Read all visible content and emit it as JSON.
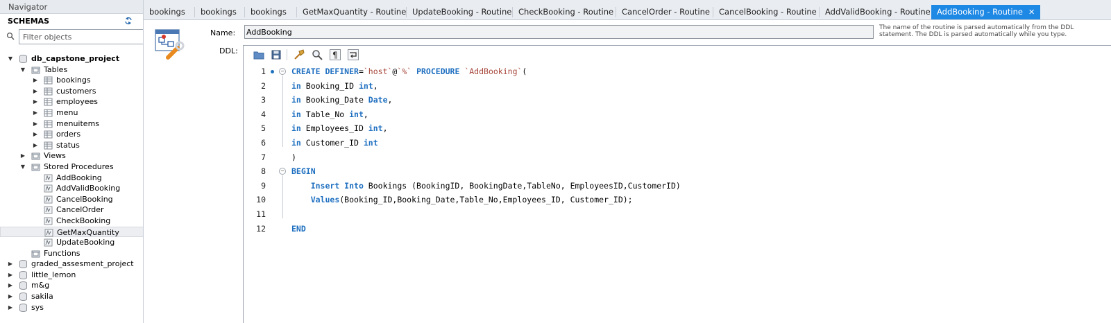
{
  "navigator": {
    "title": "Navigator",
    "schemas_label": "SCHEMAS",
    "filter_placeholder": "Filter objects",
    "tree": [
      {
        "label": "db_capstone_project",
        "level": 0,
        "arrow": "down",
        "icon": "database-icon",
        "bold": true
      },
      {
        "label": "Tables",
        "level": 1,
        "arrow": "down",
        "icon": "folder-icon"
      },
      {
        "label": "bookings",
        "level": 2,
        "arrow": "right",
        "icon": "table-icon"
      },
      {
        "label": "customers",
        "level": 2,
        "arrow": "right",
        "icon": "table-icon"
      },
      {
        "label": "employees",
        "level": 2,
        "arrow": "right",
        "icon": "table-icon"
      },
      {
        "label": "menu",
        "level": 2,
        "arrow": "right",
        "icon": "table-icon"
      },
      {
        "label": "menuitems",
        "level": 2,
        "arrow": "right",
        "icon": "table-icon"
      },
      {
        "label": "orders",
        "level": 2,
        "arrow": "right",
        "icon": "table-icon"
      },
      {
        "label": "status",
        "level": 2,
        "arrow": "right",
        "icon": "table-icon"
      },
      {
        "label": "Views",
        "level": 1,
        "arrow": "right",
        "icon": "folder-icon"
      },
      {
        "label": "Stored Procedures",
        "level": 1,
        "arrow": "down",
        "icon": "folder-icon"
      },
      {
        "label": "AddBooking",
        "level": 2,
        "arrow": "",
        "icon": "routine-icon"
      },
      {
        "label": "AddValidBooking",
        "level": 2,
        "arrow": "",
        "icon": "routine-icon"
      },
      {
        "label": "CancelBooking",
        "level": 2,
        "arrow": "",
        "icon": "routine-icon"
      },
      {
        "label": "CancelOrder",
        "level": 2,
        "arrow": "",
        "icon": "routine-icon"
      },
      {
        "label": "CheckBooking",
        "level": 2,
        "arrow": "",
        "icon": "routine-icon"
      },
      {
        "label": "GetMaxQuantity",
        "level": 2,
        "arrow": "",
        "icon": "routine-icon",
        "selected": true
      },
      {
        "label": "UpdateBooking",
        "level": 2,
        "arrow": "",
        "icon": "routine-icon"
      },
      {
        "label": "Functions",
        "level": 1,
        "arrow": "",
        "icon": "folder-icon"
      },
      {
        "label": "graded_assesment_project",
        "level": 0,
        "arrow": "right",
        "icon": "database-icon"
      },
      {
        "label": "little_lemon",
        "level": 0,
        "arrow": "right",
        "icon": "database-icon"
      },
      {
        "label": "m&g",
        "level": 0,
        "arrow": "right",
        "icon": "database-icon"
      },
      {
        "label": "sakila",
        "level": 0,
        "arrow": "right",
        "icon": "database-icon"
      },
      {
        "label": "sys",
        "level": 0,
        "arrow": "right",
        "icon": "database-icon"
      }
    ]
  },
  "tabs": [
    {
      "label": "bookings"
    },
    {
      "label": "bookings"
    },
    {
      "label": "bookings"
    },
    {
      "label": "GetMaxQuantity - Routine"
    },
    {
      "label": "UpdateBooking - Routine"
    },
    {
      "label": "CheckBooking - Routine"
    },
    {
      "label": "CancelOrder - Routine"
    },
    {
      "label": "CancelBooking - Routine"
    },
    {
      "label": "AddValidBooking - Routine"
    },
    {
      "label": "AddBooking - Routine",
      "active": true
    }
  ],
  "tab_close_glyph": "✕",
  "routine": {
    "name_label": "Name:",
    "name_value": "AddBooking",
    "hint": "The name of the routine is parsed automatically from the DDL statement. The DDL is parsed automatically while you type.",
    "ddl_label": "DDL:"
  },
  "toolbar_icons": [
    "open-folder-icon",
    "save-icon",
    "beautify-icon",
    "find-icon",
    "invisible-chars-icon",
    "word-wrap-icon"
  ],
  "code_lines": [
    {
      "n": "1",
      "marker": true,
      "fold": true,
      "tokens": [
        [
          "kw",
          "CREATE DEFINER"
        ],
        [
          "",
          "="
        ],
        [
          "str",
          "`host`"
        ],
        [
          "",
          "@"
        ],
        [
          "str",
          "`%`"
        ],
        [
          "",
          " "
        ],
        [
          "kw",
          "PROCEDURE"
        ],
        [
          "",
          " "
        ],
        [
          "str",
          "`AddBooking`"
        ],
        [
          "",
          "("
        ]
      ]
    },
    {
      "n": "2",
      "tokens": [
        [
          "kw",
          "in"
        ],
        [
          "",
          " Booking_ID "
        ],
        [
          "ty",
          "int"
        ],
        [
          "",
          ","
        ]
      ]
    },
    {
      "n": "3",
      "tokens": [
        [
          "kw",
          "in"
        ],
        [
          "",
          " Booking_Date "
        ],
        [
          "ty",
          "Date"
        ],
        [
          "",
          ","
        ]
      ]
    },
    {
      "n": "4",
      "tokens": [
        [
          "kw",
          "in"
        ],
        [
          "",
          " Table_No "
        ],
        [
          "ty",
          "int"
        ],
        [
          "",
          ","
        ]
      ]
    },
    {
      "n": "5",
      "tokens": [
        [
          "kw",
          "in"
        ],
        [
          "",
          " Employees_ID "
        ],
        [
          "ty",
          "int"
        ],
        [
          "",
          ","
        ]
      ]
    },
    {
      "n": "6",
      "tokens": [
        [
          "kw",
          "in"
        ],
        [
          "",
          " Customer_ID "
        ],
        [
          "ty",
          "int"
        ]
      ]
    },
    {
      "n": "7",
      "tokens": [
        [
          "",
          ")"
        ]
      ]
    },
    {
      "n": "8",
      "fold": true,
      "tokens": [
        [
          "kw",
          "BEGIN"
        ]
      ]
    },
    {
      "n": "9",
      "tokens": [
        [
          "",
          "    "
        ],
        [
          "kw",
          "Insert Into"
        ],
        [
          "",
          " Bookings (BookingID, BookingDate,TableNo, EmployeesID,CustomerID)"
        ]
      ]
    },
    {
      "n": "10",
      "tokens": [
        [
          "",
          "    "
        ],
        [
          "kw",
          "Values"
        ],
        [
          "",
          "(Booking_ID,Booking_Date,Table_No,Employees_ID, Customer_ID);"
        ]
      ]
    },
    {
      "n": "11",
      "tokens": []
    },
    {
      "n": "12",
      "tokens": [
        [
          "kw",
          "END"
        ]
      ]
    }
  ]
}
